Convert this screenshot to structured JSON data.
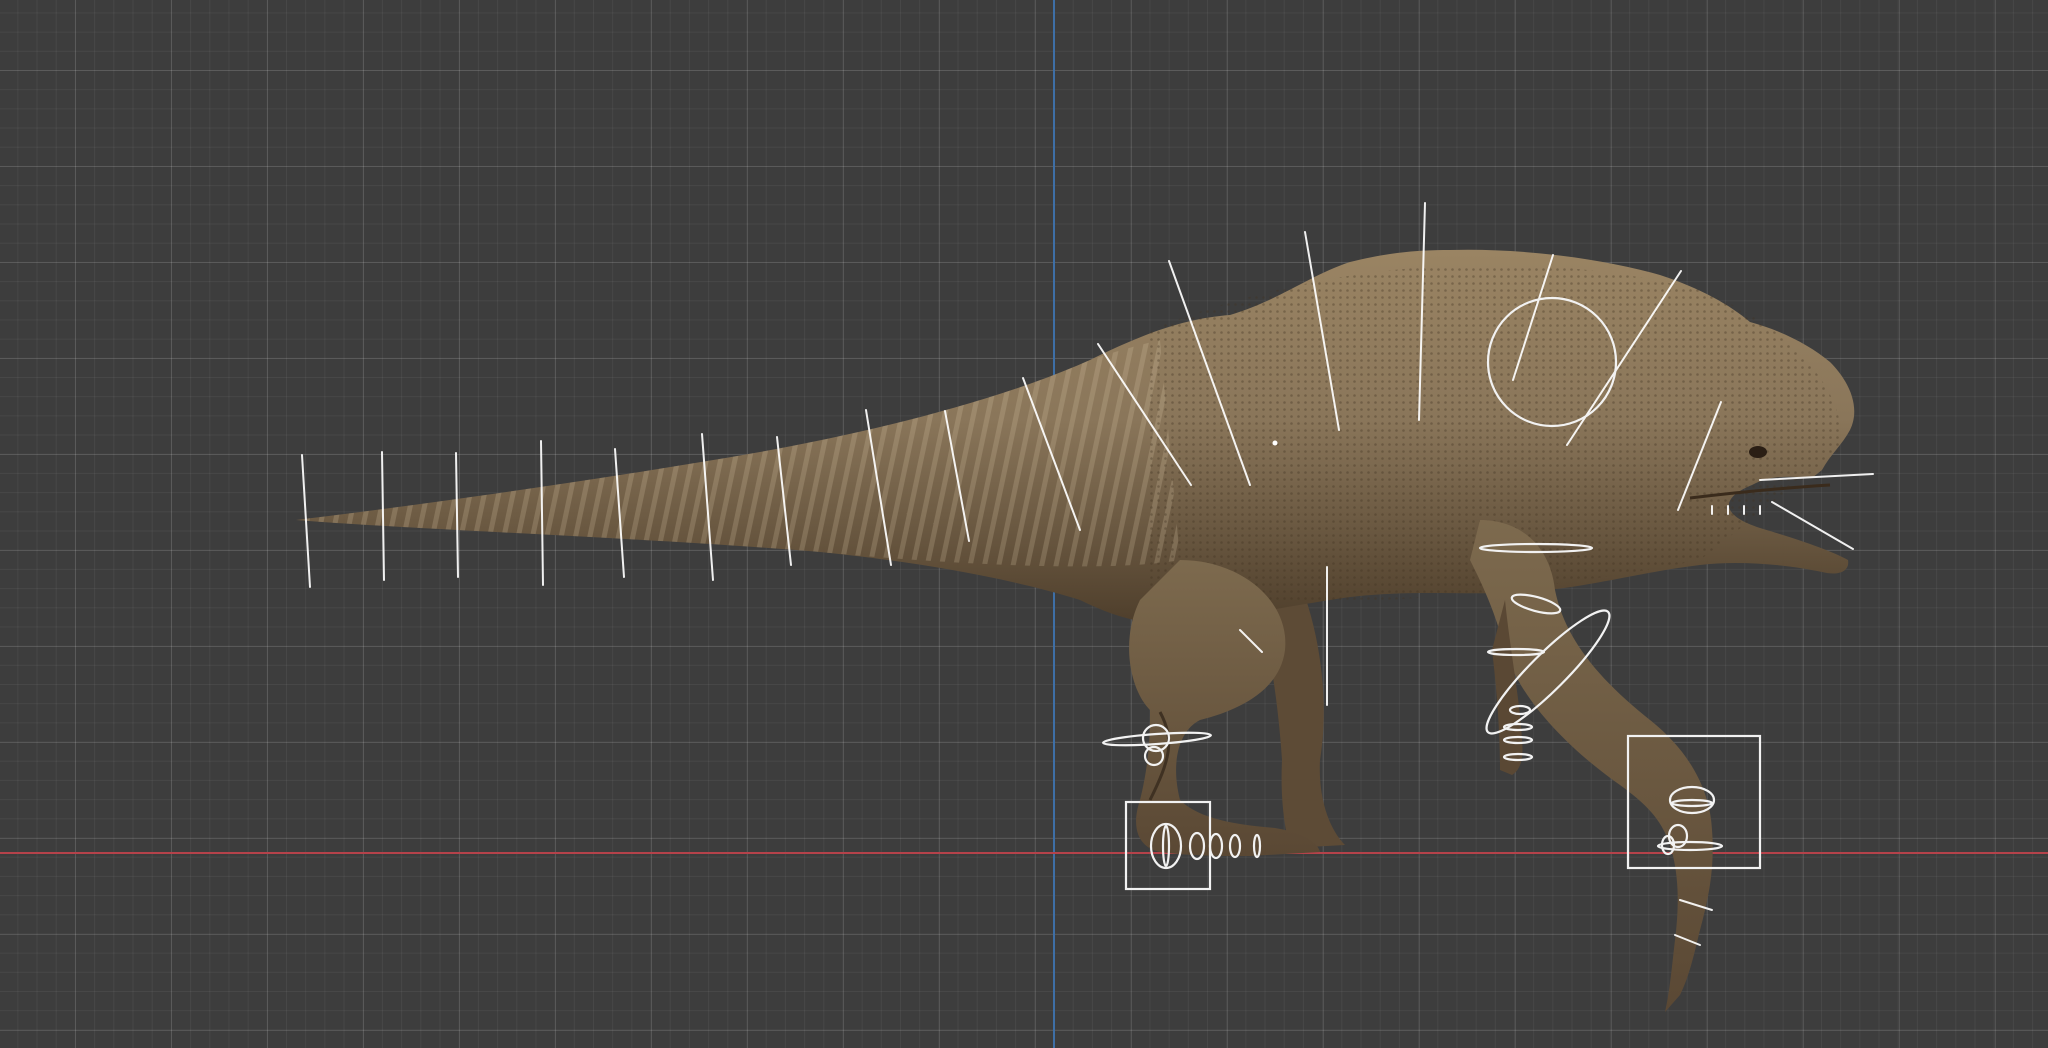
{
  "viewport": {
    "background": "#3d3d3d",
    "x_axis_color": "#b5424a",
    "y_axis_color": "#3e6fa6"
  },
  "scene": {
    "model": "dinosaur-mesh",
    "skin_colors": [
      "#8a765a",
      "#6e5a40",
      "#4a3a28",
      "#a8926f"
    ],
    "rig_color": "#ffffff"
  }
}
